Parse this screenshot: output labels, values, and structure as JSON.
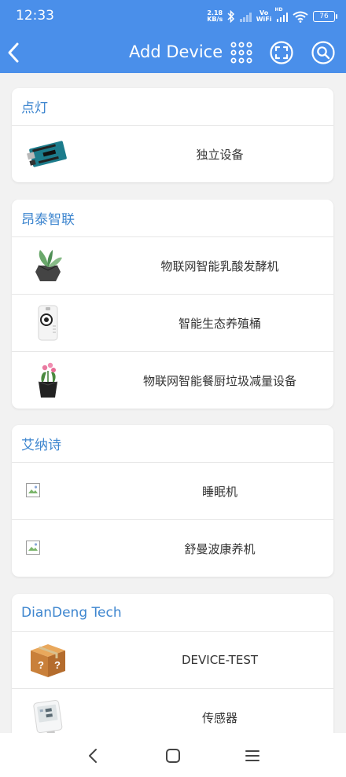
{
  "status_bar": {
    "time": "12:33",
    "net_speed_value": "2.18",
    "net_speed_unit": "KB/s",
    "vowifi_top": "Vo",
    "vowifi_bottom": "WiFi",
    "hd_label": "HD",
    "battery": "76"
  },
  "app_bar": {
    "title": "Add Device",
    "icons": [
      "back-arrow-icon",
      "grid-dots-icon",
      "scan-icon",
      "search-icon"
    ]
  },
  "groups": [
    {
      "title": "点灯",
      "devices": [
        {
          "name": "独立设备",
          "image": "arduino-board-icon"
        }
      ]
    },
    {
      "title": "昂泰智联",
      "devices": [
        {
          "name": "物联网智能乳酸发酵机",
          "image": "planter-icon"
        },
        {
          "name": "智能生态养殖桶",
          "image": "white-box-device-icon"
        },
        {
          "name": "物联网智能餐厨垃圾减量设备",
          "image": "flower-pot-icon"
        }
      ]
    },
    {
      "title": "艾纳诗",
      "devices": [
        {
          "name": "睡眠机",
          "image": "broken-image-icon"
        },
        {
          "name": "舒曼波康养机",
          "image": "broken-image-icon"
        }
      ]
    },
    {
      "title": "DianDeng Tech",
      "devices": [
        {
          "name": "DEVICE-TEST",
          "image": "cardboard-box-icon"
        },
        {
          "name": "传感器",
          "image": "thermo-hygrometer-icon"
        }
      ]
    }
  ],
  "nav_bar": {
    "icons": [
      "back-icon",
      "home-icon",
      "menu-icon"
    ]
  }
}
